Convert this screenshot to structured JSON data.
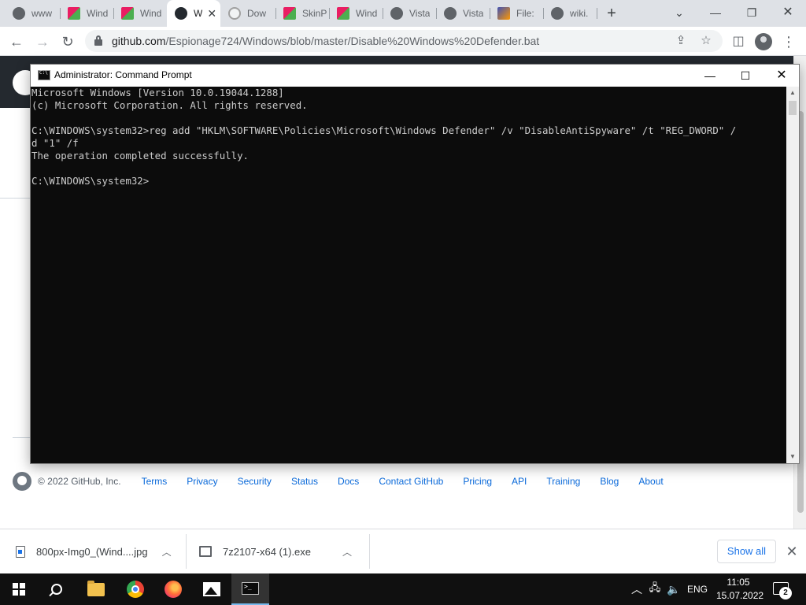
{
  "browser": {
    "tabs": [
      {
        "title": "www",
        "favicon": "globe-icon",
        "active": false
      },
      {
        "title": "Wind",
        "favicon": "skinpack-icon",
        "active": false
      },
      {
        "title": "Wind",
        "favicon": "skinpack-icon",
        "active": false
      },
      {
        "title": "W",
        "favicon": "github-icon",
        "active": true
      },
      {
        "title": "Dow",
        "favicon": "download-site-icon",
        "active": false
      },
      {
        "title": "SkinP",
        "favicon": "skinpack-icon",
        "active": false
      },
      {
        "title": "Wind",
        "favicon": "skinpack-icon",
        "active": false
      },
      {
        "title": "Vista",
        "favicon": "globe-icon",
        "active": false
      },
      {
        "title": "Vista",
        "favicon": "globe-icon",
        "active": false
      },
      {
        "title": "File:",
        "favicon": "file-icon",
        "active": false
      },
      {
        "title": "wiki.",
        "favicon": "globe-icon",
        "active": false
      }
    ],
    "new_tab_label": "+",
    "url_host": "github.com",
    "url_path": "/Espionage724/Windows/blob/master/Disable%20Windows%20Defender.bat"
  },
  "github_footer": {
    "copyright": "© 2022 GitHub, Inc.",
    "links": [
      "Terms",
      "Privacy",
      "Security",
      "Status",
      "Docs",
      "Contact GitHub",
      "Pricing",
      "API",
      "Training",
      "Blog",
      "About"
    ]
  },
  "cmd": {
    "title": "Administrator: Command Prompt",
    "lines": [
      "Microsoft Windows [Version 10.0.19044.1288]",
      "(c) Microsoft Corporation. All rights reserved.",
      "",
      "C:\\WINDOWS\\system32>reg add \"HKLM\\SOFTWARE\\Policies\\Microsoft\\Windows Defender\" /v \"DisableAntiSpyware\" /t \"REG_DWORD\" /",
      "d \"1\" /f",
      "The operation completed successfully.",
      "",
      "C:\\WINDOWS\\system32>"
    ]
  },
  "downloads": {
    "items": [
      {
        "name": "800px-Img0_(Wind....jpg",
        "icon": "image-file-icon"
      },
      {
        "name": "7z2107-x64 (1).exe",
        "icon": "7zip-file-icon"
      }
    ],
    "show_all": "Show all"
  },
  "taskbar": {
    "apps": [
      "start",
      "search",
      "file-explorer",
      "chrome",
      "firefox",
      "photos",
      "command-prompt"
    ],
    "active_app": "command-prompt",
    "language": "ENG",
    "time": "11:05",
    "date": "15.07.2022",
    "notification_count": "2"
  }
}
